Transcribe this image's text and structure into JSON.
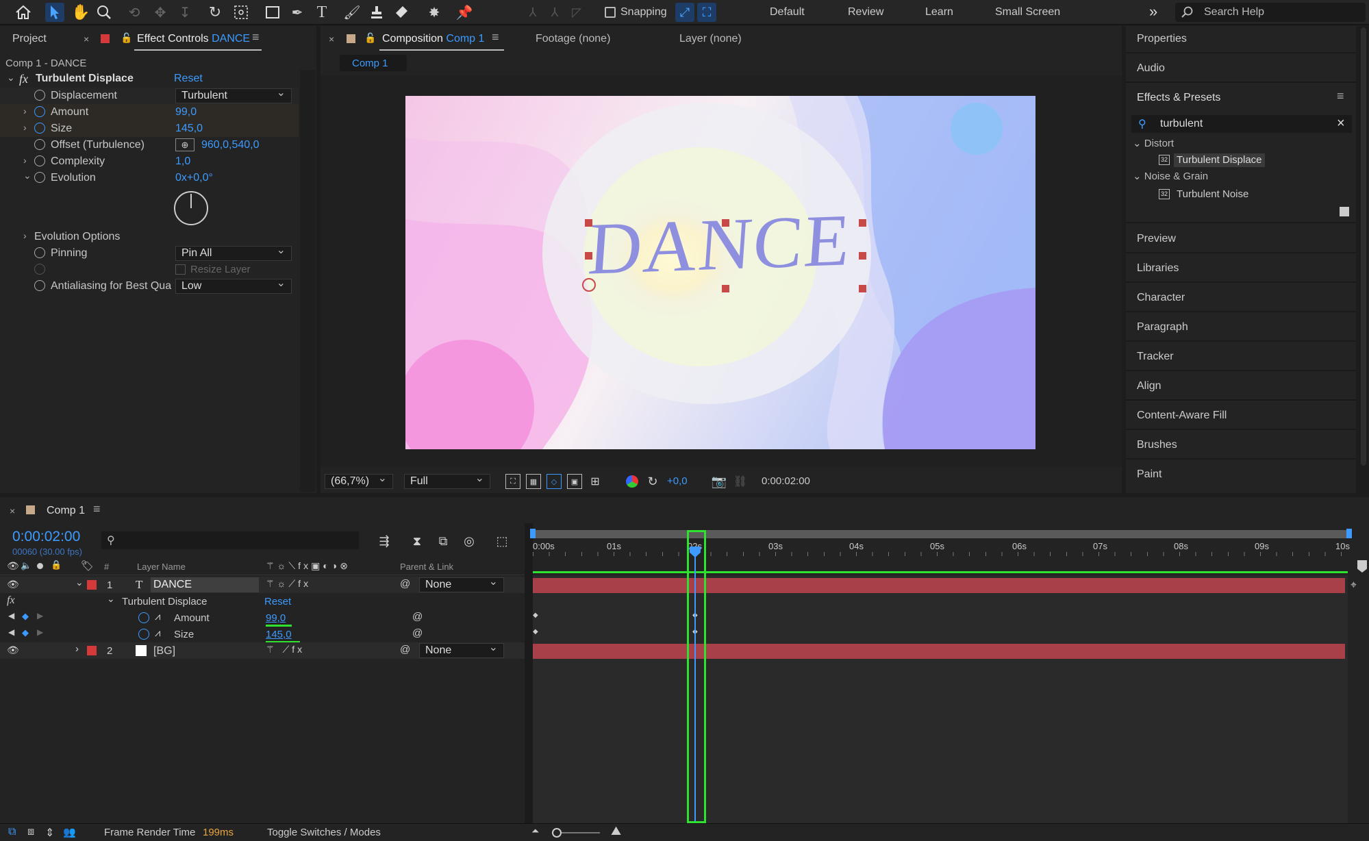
{
  "toolbar": {
    "snapping_label": "Snapping",
    "workspaces": [
      "Default",
      "Review",
      "Learn",
      "Small Screen"
    ],
    "overflow_icon": "»",
    "search_placeholder": "Search Help"
  },
  "left_panel": {
    "tab_project": "Project",
    "tab_effect_controls_prefix": "Effect Controls",
    "tab_effect_controls_layer": "DANCE",
    "subtitle": "Comp 1 - DANCE",
    "effect_name": "Turbulent Displace",
    "reset_label": "Reset",
    "props": [
      {
        "label": "Displacement",
        "value": "Turbulent"
      },
      {
        "label": "Amount",
        "value": "99,0"
      },
      {
        "label": "Size",
        "value": "145,0"
      },
      {
        "label": "Offset (Turbulence)",
        "value": "960,0,540,0"
      },
      {
        "label": "Complexity",
        "value": "1,0"
      },
      {
        "label": "Evolution",
        "value": "0x+0,0°"
      },
      {
        "label": "Evolution Options",
        "value": ""
      },
      {
        "label": "Pinning",
        "value": "Pin All"
      },
      {
        "label": "Resize Layer",
        "value": ""
      },
      {
        "label": "Antialiasing for Best Qua",
        "value": "Low"
      }
    ]
  },
  "comp_panel": {
    "tab_composition_prefix": "Composition",
    "tab_composition_name": "Comp 1",
    "tab_footage": "Footage (none)",
    "tab_layer": "Layer (none)",
    "breadcrumb": "Comp 1",
    "canvas_text": "DANCE",
    "zoom": "(66,7%)",
    "resolution": "Full",
    "exposure": "+0,0",
    "timecode": "0:00:02:00"
  },
  "right_panel": {
    "properties": "Properties",
    "audio": "Audio",
    "effects_presets": "Effects & Presets",
    "search_value": "turbulent",
    "group_distort": "Distort",
    "item_turbulent_displace": "Turbulent Displace",
    "group_noise": "Noise & Grain",
    "item_turbulent_noise": "Turbulent Noise",
    "panels": [
      "Preview",
      "Libraries",
      "Character",
      "Paragraph",
      "Tracker",
      "Align",
      "Content-Aware Fill",
      "Brushes",
      "Paint"
    ]
  },
  "timeline": {
    "tab_name": "Comp 1",
    "current_time": "0:00:02:00",
    "frame_info": "00060 (30.00 fps)",
    "col_hash": "#",
    "col_layer_name": "Layer Name",
    "col_parent": "Parent & Link",
    "ruler_labels": [
      "0:00s",
      "01s",
      "02s",
      "03s",
      "04s",
      "05s",
      "06s",
      "07s",
      "08s",
      "09s",
      "10s"
    ],
    "layers": [
      {
        "num": "1",
        "name": "DANCE",
        "parent": "None"
      },
      {
        "num": "2",
        "name": "[BG]",
        "parent": "None"
      }
    ],
    "effect_row": {
      "fx": "fx",
      "name": "Turbulent Displace",
      "reset": "Reset"
    },
    "amount_row": {
      "label": "Amount",
      "value": "99,0"
    },
    "size_row": {
      "label": "Size",
      "value": "145,0"
    }
  },
  "status_bar": {
    "frame_render_label": "Frame Render Time",
    "frame_render_value": "199ms",
    "toggle_label": "Toggle Switches / Modes"
  },
  "colors": {
    "accent_blue": "#3d9bff",
    "highlight_green": "#2fe22f",
    "layer_bar_red": "#a8404a",
    "label_red": "#d43a3a"
  }
}
